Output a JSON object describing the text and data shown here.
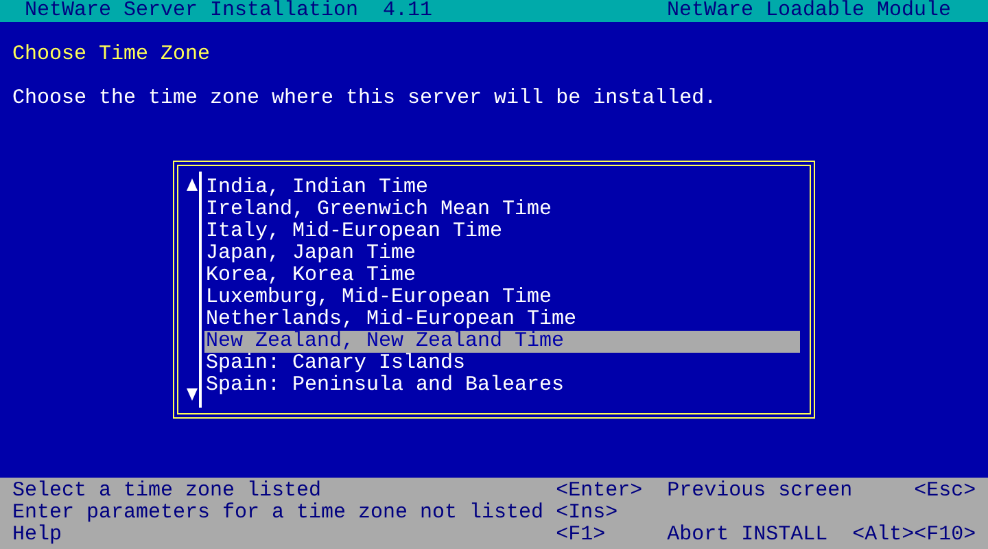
{
  "header": {
    "title": "NetWare Server Installation  4.11",
    "module": "NetWare Loadable Module"
  },
  "heading": "Choose Time Zone",
  "instruction": "Choose the time zone where this server will be installed.",
  "time_zones": [
    {
      "label": "India, Indian Time",
      "selected": false
    },
    {
      "label": "Ireland, Greenwich Mean Time",
      "selected": false
    },
    {
      "label": "Italy, Mid-European Time",
      "selected": false
    },
    {
      "label": "Japan, Japan Time",
      "selected": false
    },
    {
      "label": "Korea, Korea Time",
      "selected": false
    },
    {
      "label": "Luxemburg, Mid-European Time",
      "selected": false
    },
    {
      "label": "Netherlands, Mid-European Time",
      "selected": false
    },
    {
      "label": "New Zealand, New Zealand Time",
      "selected": true
    },
    {
      "label": "Spain: Canary Islands",
      "selected": false
    },
    {
      "label": "Spain: Peninsula and Baleares",
      "selected": false
    }
  ],
  "help_bar": [
    {
      "description": "Select a time zone listed",
      "key": "<Enter>",
      "action": "Previous screen",
      "action_key": "<Esc>"
    },
    {
      "description": "Enter parameters for a time zone not listed",
      "key": "<Ins>"
    },
    {
      "description": "Help",
      "key": "<F1>",
      "action": "Abort INSTALL",
      "action_key": "<Alt><F10>"
    }
  ]
}
